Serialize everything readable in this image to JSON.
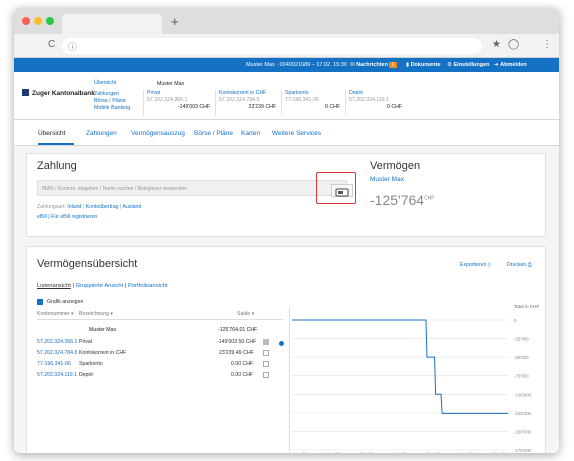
{
  "browser": {
    "tab_title": "",
    "url": ""
  },
  "topbar": {
    "user_info": "Muster Max · 0040021689 – 17.02. 15:30",
    "messages": "Nachrichten",
    "messages_count": "1",
    "documents": "Dokumente",
    "settings": "Einstellungen",
    "logout": "Abmelden"
  },
  "header": {
    "bank_name": "Zuger Kantonalbank",
    "links": [
      "Übersicht",
      "Zahlungen",
      "Börse / Pläne",
      "Mobile Banking"
    ],
    "owner": "Muster Max",
    "accounts": [
      {
        "label": "Privat",
        "number": "57.202.324.366.1",
        "value": "-149'003 CHF"
      },
      {
        "label": "Kontokorrent in CHF",
        "number": "57.202.324.784.5",
        "value": "23'239 CHF"
      },
      {
        "label": "Sparkonto",
        "number": "77-196.341-06",
        "value": "0 CHF"
      },
      {
        "label": "Depot",
        "number": "57.202.324.119.1",
        "value": "0 CHF"
      }
    ]
  },
  "nav": {
    "tabs": [
      "Übersicht",
      "Zahlungen",
      "Vermögensauszug",
      "Börse / Pläne",
      "Karten",
      "Weitere Services"
    ]
  },
  "payment": {
    "title": "Zahlung",
    "placeholder": "IBAN / Kontonr. eingeben / Name suchen / Belegleser verwenden",
    "type_label": "Zahlungsart:",
    "types": [
      "Inland",
      "Kontoübertrag",
      "Ausland"
    ],
    "ebill": "eBill | Für eBill registrieren"
  },
  "wealth": {
    "title": "Vermögen",
    "owner": "Muster Max",
    "total": "-125'764",
    "currency": "CHF"
  },
  "overview": {
    "title": "Vermögensübersicht",
    "export": "Exportieren",
    "print": "Drucken",
    "views": [
      "Listenansicht",
      "Gruppierte Ansicht",
      "Portfolioansicht"
    ],
    "show_chart": "Grafik anzeigen",
    "col_account": "Kontonummer ▾",
    "col_desc": "Bezeichnung ▾",
    "col_balance": "Saldo ▾",
    "owner_row": {
      "name": "Muster Max",
      "balance": "-125'764.01 CHF"
    },
    "rows": [
      {
        "account": "57.202.324.366.1",
        "desc": "Privat",
        "balance": "-149'003.50 CHF"
      },
      {
        "account": "57.202.324.784.5",
        "desc": "Kontokorrent in CHF",
        "balance": "23'239.49 CHF"
      },
      {
        "account": "77-196.341-06",
        "desc": "Sparkonto",
        "balance": "0.00 CHF"
      },
      {
        "account": "57.202.324.119.1",
        "desc": "Depot",
        "balance": "0.00 CHF"
      }
    ]
  },
  "chart_data": {
    "type": "line",
    "ylabel": "Total in CHF",
    "yticks": [
      "0",
      "-25'000",
      "-50'000",
      "-75'000",
      "-100'000",
      "-125'000",
      "-150'000",
      "-175'000"
    ],
    "xticks": [
      "Aug. 23",
      "Sep. 23",
      "Okt. 23",
      "Nov. 23",
      "Dez. 23",
      "Jan. 24",
      "Feb. 24"
    ],
    "x": [
      0,
      0.62,
      0.625,
      0.66,
      0.665,
      0.69,
      0.695,
      1
    ],
    "values": [
      0,
      0,
      -50000,
      -50000,
      -100000,
      -100000,
      -125764,
      -125764
    ],
    "ylim": [
      -175000,
      0
    ]
  }
}
